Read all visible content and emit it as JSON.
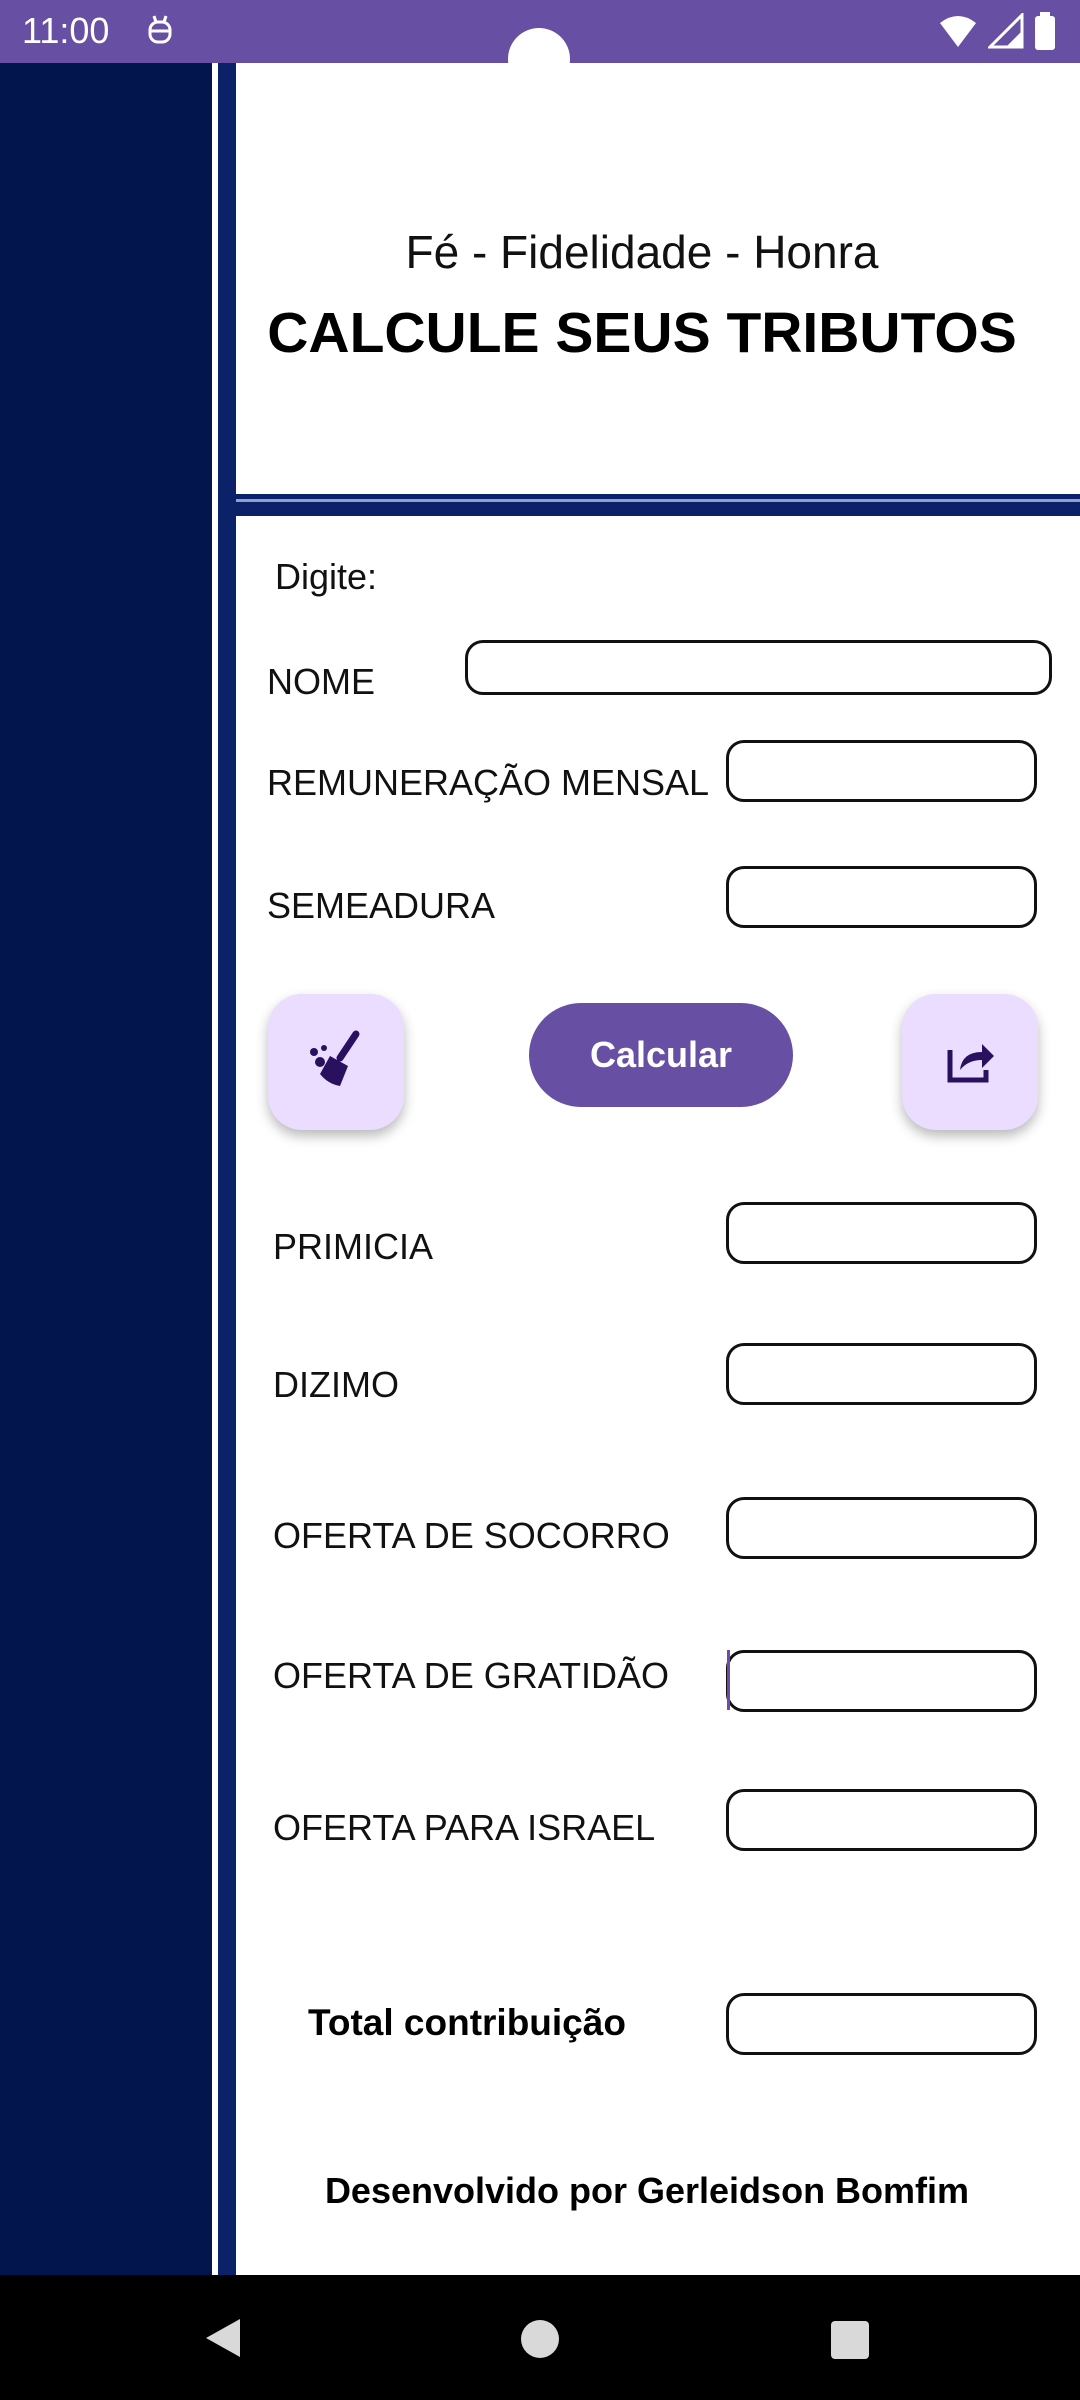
{
  "status_bar": {
    "time": "11:00",
    "notification_icon": "android-debug-icon",
    "icons": [
      "wifi-icon",
      "signal-icon",
      "battery-icon"
    ],
    "color": "#6750a4"
  },
  "header": {
    "motto": "Fé - Fidelidade - Honra",
    "title": "CALCULE SEUS TRIBUTOS"
  },
  "form": {
    "prompt": "Digite:",
    "nome_label": "NOME",
    "nome_value": "",
    "remuneracao_label": "REMUNERAÇÃO MENSAL",
    "remuneracao_value": "",
    "semeadura_label": "SEMEADURA",
    "semeadura_value": ""
  },
  "actions": {
    "clear_icon": "broom-icon",
    "calculate_label": "Calcular",
    "share_icon": "share-icon",
    "accent": "#6750a4",
    "fab_color": "#eaddff"
  },
  "results": {
    "primicia_label": "PRIMICIA",
    "dizimo_label": "DIZIMO",
    "socorro_label": "OFERTA DE SOCORRO",
    "gratidao_label": "OFERTA DE GRATIDÃO",
    "israel_label": "OFERTA PARA ISRAEL",
    "total_label": "Total contribuição"
  },
  "footer": {
    "credit": "Desenvolvido por Gerleidson Bomfim"
  },
  "nav_bar": {
    "icons": [
      "back-icon",
      "home-icon",
      "recents-icon"
    ]
  },
  "colors": {
    "side_panel": "#02154d",
    "divider": "#0b2268"
  }
}
